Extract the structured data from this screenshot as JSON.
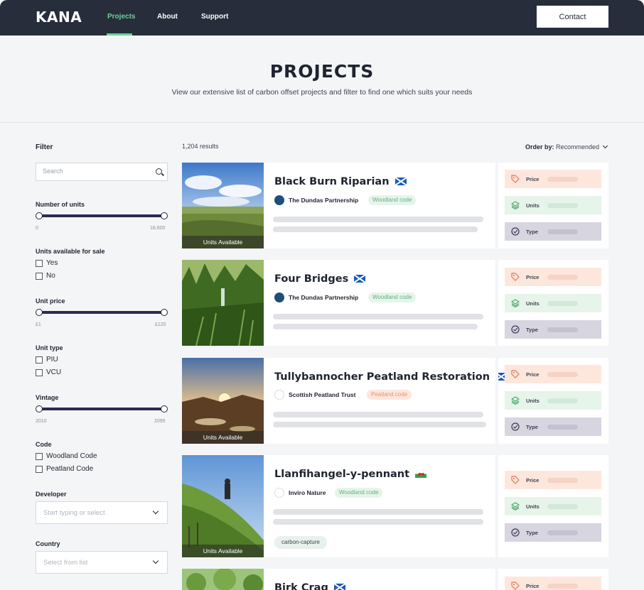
{
  "nav": {
    "logo": "KANA",
    "links": [
      "Projects",
      "About",
      "Support"
    ],
    "active_index": 0,
    "contact_label": "Contact",
    "accent_color": "#6fcf97",
    "bg_color": "#272d3b"
  },
  "hero": {
    "title": "PROJECTS",
    "subtitle": "View our extensive list of carbon offset projects and filter to find one which suits your needs"
  },
  "filter": {
    "title": "Filter",
    "search_placeholder": "Search",
    "number_of_units": {
      "label": "Number of units",
      "min": "0",
      "max": "18,600"
    },
    "units_available": {
      "label": "Units available for sale",
      "options": [
        "Yes",
        "No"
      ]
    },
    "unit_price": {
      "label": "Unit price",
      "min": "£1",
      "max": "£120"
    },
    "unit_type": {
      "label": "Unit type",
      "options": [
        "PIU",
        "VCU"
      ]
    },
    "vintage": {
      "label": "Vintage",
      "min": "2010",
      "max": "2095"
    },
    "code": {
      "label": "Code",
      "options": [
        "Woodland Code",
        "Peatland Code"
      ]
    },
    "developer": {
      "label": "Developer",
      "placeholder": "Start typing or select"
    },
    "country": {
      "label": "Country",
      "placeholder": "Select from list"
    }
  },
  "results": {
    "count": "1,204 results",
    "order_by_label": "Order by:",
    "order_by_value": "Recommended"
  },
  "attribute_labels": {
    "price": "Price",
    "units": "Units",
    "type": "Type"
  },
  "projects": [
    {
      "title": "Black Burn Riparian",
      "flag": "scotland-flag",
      "developer": "The Dundas Partnership",
      "code": "Woodland code",
      "available": "Units Available"
    },
    {
      "title": "Four Bridges",
      "flag": "scotland-flag",
      "developer": "The Dundas Partnership",
      "code": "Woodland code",
      "available": ""
    },
    {
      "title": "Tullybannocher Peatland Restoration",
      "flag": "scotland-flag",
      "developer": "Scottish Peatland Trust",
      "code": "Peatland code",
      "available": "Units Available"
    },
    {
      "title": "Llanfihangel-y-pennant",
      "flag": "wales-flag",
      "developer": "Inviro Nature",
      "code": "Woodland code",
      "available": "Units Available",
      "tag": "carbon-capture"
    },
    {
      "title": "Birk Crag",
      "flag": "scotland-flag"
    }
  ]
}
